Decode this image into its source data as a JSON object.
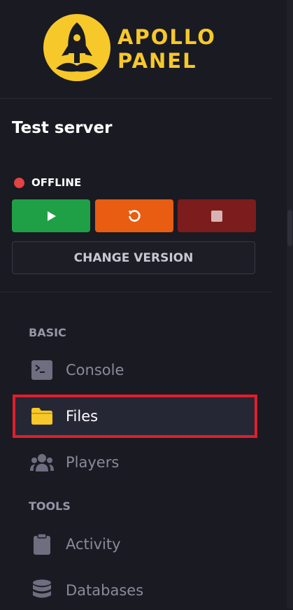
{
  "brand": {
    "line1": "APOLLO",
    "line2": "PANEL",
    "color": "#f6c82a"
  },
  "server": {
    "name": "Test server",
    "status": "OFFLINE",
    "status_color": "#e24343"
  },
  "power_buttons": {
    "start_icon": "play-icon",
    "restart_icon": "restart-icon",
    "stop_icon": "stop-icon"
  },
  "change_version_label": "CHANGE VERSION",
  "nav": {
    "basic_header": "BASIC",
    "tools_header": "TOOLS",
    "items": [
      {
        "label": "Console",
        "icon": "terminal-icon"
      },
      {
        "label": "Files",
        "icon": "folder-icon",
        "active": true
      },
      {
        "label": "Players",
        "icon": "users-icon"
      },
      {
        "label": "Activity",
        "icon": "clipboard-icon"
      },
      {
        "label": "Databases",
        "icon": "database-icon"
      }
    ]
  },
  "colors": {
    "start": "#1fa046",
    "restart": "#e85d12",
    "stop": "#7d1c1c",
    "highlight_border": "#e01e2c"
  }
}
